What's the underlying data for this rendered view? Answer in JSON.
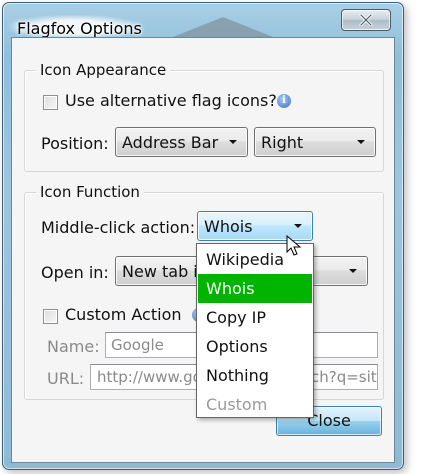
{
  "window": {
    "title": "Flagfox Options"
  },
  "icon_appearance": {
    "group_title": "Icon Appearance",
    "alt_flag_label": "Use alternative flag icons?",
    "alt_flag_checked": false,
    "info_icon": "info-icon",
    "position_label": "Position:",
    "position_value": "Address Bar",
    "side_value": "Right"
  },
  "icon_function": {
    "group_title": "Icon Function",
    "middle_click_label": "Middle-click action:",
    "middle_click_value": "Whois",
    "open_in_label": "Open in:",
    "open_in_value": "New tab in",
    "custom_action_label": "Custom Action",
    "custom_action_checked": false,
    "name_label": "Name:",
    "name_value": "Google",
    "url_label": "URL:",
    "url_value_left": "http://www.go",
    "url_value_right": "ch?q=sit"
  },
  "dropdown": {
    "items": [
      {
        "label": "Wikipedia",
        "state": "normal"
      },
      {
        "label": "Whois",
        "state": "selected"
      },
      {
        "label": "Copy IP",
        "state": "normal"
      },
      {
        "label": "Options",
        "state": "normal"
      },
      {
        "label": "Nothing",
        "state": "normal"
      },
      {
        "label": "Custom",
        "state": "disabled"
      }
    ],
    "selected_color": "#00b400"
  },
  "buttons": {
    "close_label": "Close"
  },
  "colors": {
    "accent": "#3c7fb1",
    "window_frame": "#9cc6de"
  }
}
